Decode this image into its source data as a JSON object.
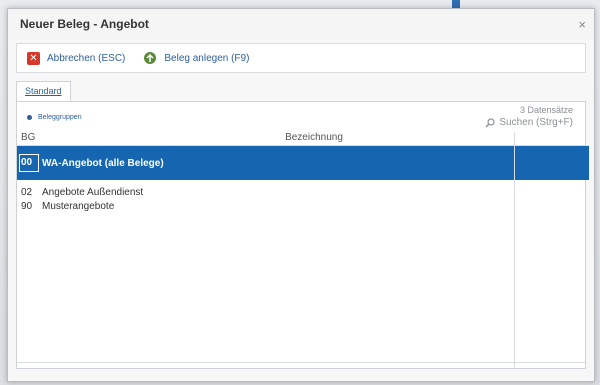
{
  "window": {
    "title": "Neuer Beleg - Angebot",
    "close_glyph": "×"
  },
  "toolbar": {
    "cancel_label": "Abbrechen (ESC)",
    "create_label": "Beleg anlegen (F9)"
  },
  "tabs": [
    {
      "label": "Standard"
    }
  ],
  "panel": {
    "groups_label": "Beleggruppen",
    "record_count": "3 Datensätze",
    "search_label": "Suchen (Strg+F)"
  },
  "table": {
    "headers": {
      "bg": "BG",
      "bez": "Bezeichnung"
    },
    "rows": [
      {
        "bg": "00",
        "bez": "WA-Angebot (alle Belege)",
        "selected": true
      },
      {
        "bg": "02",
        "bez": "Angebote Außendienst",
        "selected": false
      },
      {
        "bg": "90",
        "bez": "Musterangebote",
        "selected": false
      }
    ]
  },
  "colors": {
    "accent": "#1565b0",
    "link": "#2d5fa0",
    "cancel_icon": "#d33a2c"
  }
}
